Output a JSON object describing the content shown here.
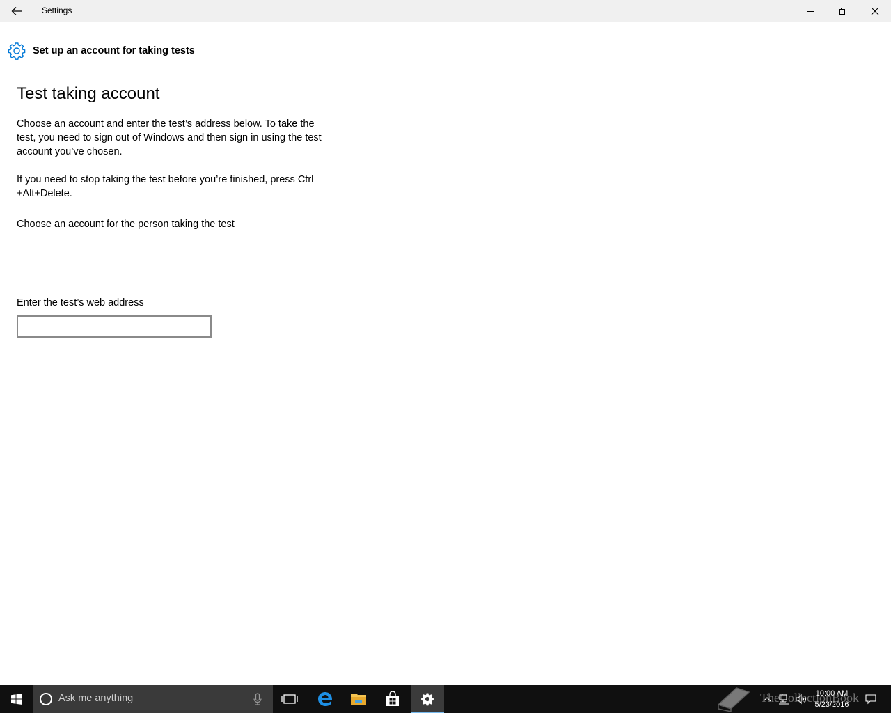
{
  "window": {
    "title": "Settings",
    "minimize_icon": "minimize-icon",
    "maximize_icon": "restore-icon",
    "close_icon": "close-icon"
  },
  "header": {
    "icon": "gear-icon",
    "text": "Set up an account for taking tests"
  },
  "main": {
    "title": "Test taking account",
    "paragraph1": "Choose an account and enter the test’s address below. To take the test, you need to sign out of Windows and then sign in using the test account you’ve chosen.",
    "paragraph2": "If you need to stop taking the test before you’re finished, press Ctrl +Alt+Delete.",
    "choose_account_label": "Choose an account for the person taking the test",
    "url_label": "Enter the test’s web address",
    "url_value": ""
  },
  "taskbar": {
    "search_placeholder": "Ask me anything",
    "apps": [
      "task-view-icon",
      "edge-icon",
      "file-explorer-icon",
      "store-icon",
      "settings-icon"
    ],
    "time": "10:00 AM",
    "date": "5/23/2016"
  },
  "watermark": {
    "text": "TheCollectionBook"
  },
  "colors": {
    "accent": "#0078d7",
    "titlebar": "#f0f0f0",
    "taskbar": "#101010",
    "search_box": "#3a3a3a"
  }
}
